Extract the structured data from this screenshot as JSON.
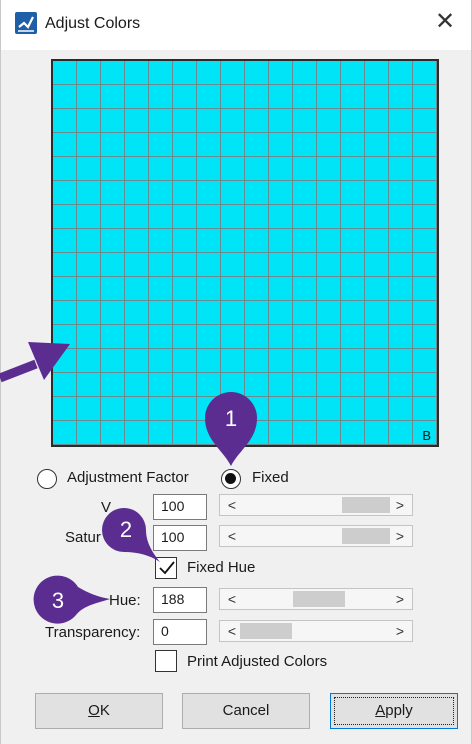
{
  "window": {
    "title": "Adjust Colors",
    "close_glyph": "✕"
  },
  "icons": {
    "app": "adjust-colors-app-icon",
    "close": "close-icon"
  },
  "preview": {
    "corner_label": "B",
    "fill_color": "#00e4f7"
  },
  "mode": {
    "adjustment_factor_label": "Adjustment Factor",
    "fixed_label": "Fixed",
    "selected": "Fixed"
  },
  "value": {
    "label": "V",
    "value": "100",
    "scroll_fraction": 1.0
  },
  "saturation": {
    "label": "Satur",
    "value": "100",
    "scroll_fraction": 1.0
  },
  "fixed_hue": {
    "label": "Fixed Hue",
    "checked": true
  },
  "hue": {
    "label": "Hue:",
    "value": "188",
    "scroll_fraction": 0.52
  },
  "transparency": {
    "label": "Transparency:",
    "value": "0",
    "scroll_fraction": 0.0
  },
  "print_adjusted": {
    "label": "Print Adjusted Colors",
    "checked": false
  },
  "buttons": {
    "ok_accel": "O",
    "ok_rest": "K",
    "cancel": "Cancel",
    "apply_accel": "A",
    "apply_rest": "pply"
  },
  "scroll_arrows": {
    "left": "<",
    "right": ">"
  },
  "callouts": [
    {
      "number": "1"
    },
    {
      "number": "2"
    },
    {
      "number": "3"
    }
  ],
  "colors": {
    "callout": "#5b2d91",
    "window_bg": "#f0f0f0",
    "accent": "#0078d7"
  }
}
